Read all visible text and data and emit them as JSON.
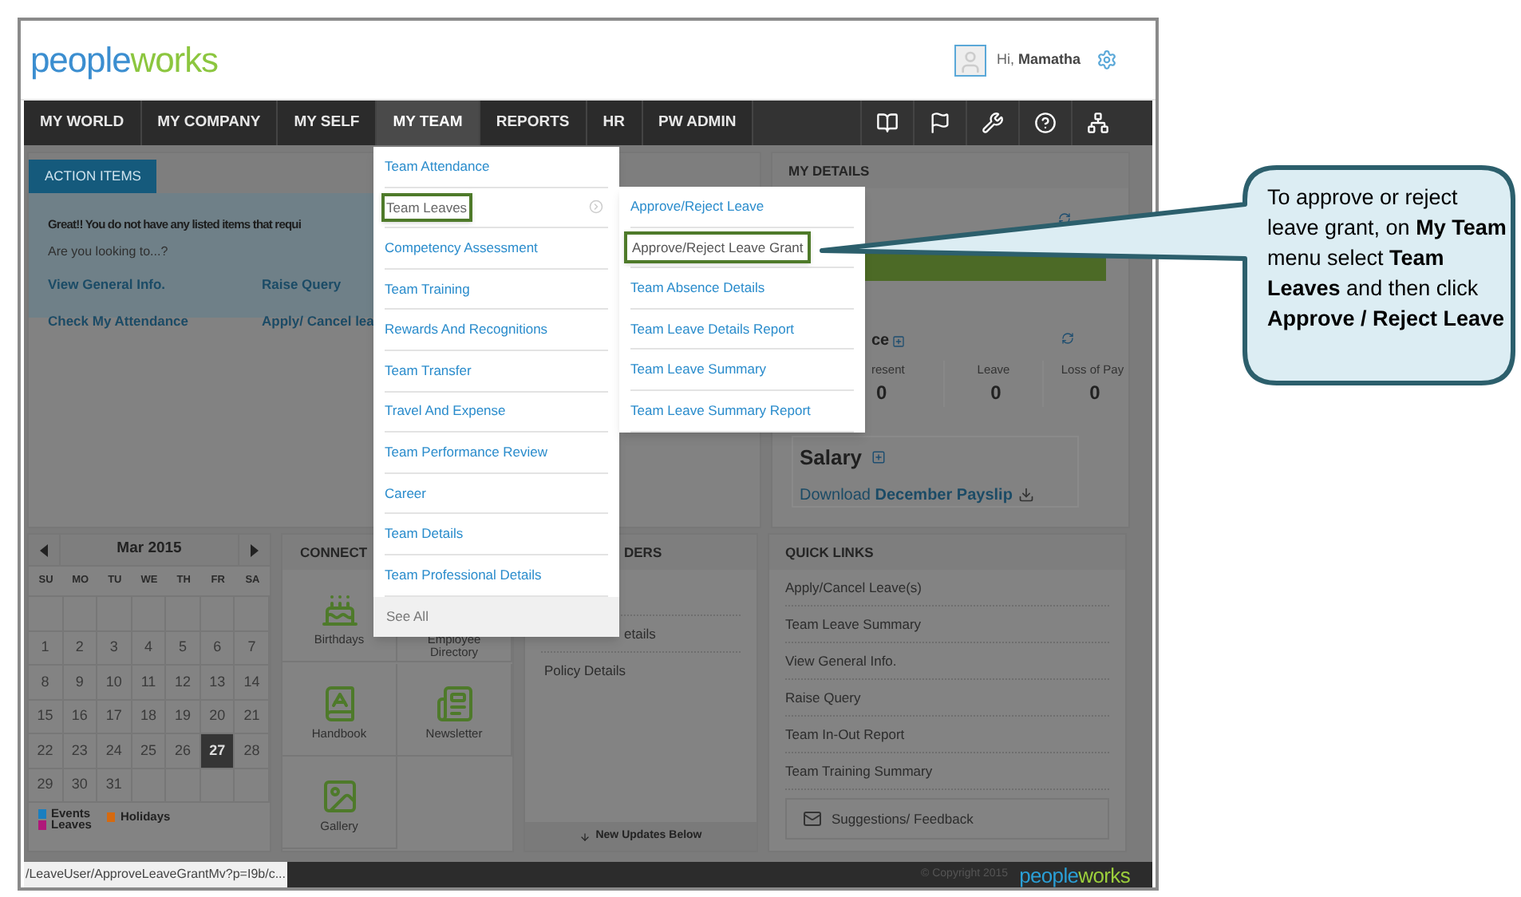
{
  "header": {
    "logo": [
      "people",
      "works"
    ],
    "greeting": "Hi,",
    "user": "Mamatha"
  },
  "nav": [
    {
      "label": "MY WORLD",
      "selected": false
    },
    {
      "label": "MY COMPANY",
      "selected": false
    },
    {
      "label": "MY SELF",
      "selected": false
    },
    {
      "label": "MY TEAM",
      "selected": true
    },
    {
      "label": "REPORTS",
      "selected": false
    },
    {
      "label": "HR",
      "selected": false
    },
    {
      "label": "PW ADMIN",
      "selected": false
    }
  ],
  "action_items": {
    "tab": "ACTION ITEMS",
    "message": "Great!! You do not have any listed items that requi",
    "prompt": "Are you looking to...?",
    "links": [
      "View General Info.",
      "Raise Query",
      "Check My Attendance",
      "Apply/ Cancel lea"
    ]
  },
  "my_details": {
    "title": "MY DETAILS",
    "attendance_title": "ce",
    "columns": [
      {
        "label": "resent",
        "value": "0"
      },
      {
        "label": "Leave",
        "value": "0"
      },
      {
        "label": "Loss of Pay",
        "value": "0"
      }
    ],
    "salary_title": "Salary",
    "payslip": "Download **December Payslip**"
  },
  "calendar": {
    "month": "Mar 2015",
    "weekdays": [
      "SU",
      "MO",
      "TU",
      "WE",
      "TH",
      "FR",
      "SA"
    ],
    "leading_blank_week": true,
    "weeks": [
      [
        {
          "d": "1",
          "selected": false
        },
        {
          "d": "2",
          "selected": false
        },
        {
          "d": "3",
          "selected": false
        },
        {
          "d": "4",
          "selected": false
        },
        {
          "d": "5",
          "selected": false
        },
        {
          "d": "6",
          "selected": false
        },
        {
          "d": "7",
          "selected": false
        }
      ],
      [
        {
          "d": "8",
          "selected": false
        },
        {
          "d": "9",
          "selected": false
        },
        {
          "d": "10",
          "selected": false
        },
        {
          "d": "11",
          "selected": false
        },
        {
          "d": "12",
          "selected": false
        },
        {
          "d": "13",
          "selected": false
        },
        {
          "d": "14",
          "selected": false
        }
      ],
      [
        {
          "d": "15",
          "selected": false
        },
        {
          "d": "16",
          "selected": false
        },
        {
          "d": "17",
          "selected": false
        },
        {
          "d": "18",
          "selected": false
        },
        {
          "d": "19",
          "selected": false
        },
        {
          "d": "20",
          "selected": false
        },
        {
          "d": "21",
          "selected": false
        }
      ],
      [
        {
          "d": "22",
          "selected": false
        },
        {
          "d": "23",
          "selected": false
        },
        {
          "d": "24",
          "selected": false
        },
        {
          "d": "25",
          "selected": false
        },
        {
          "d": "26",
          "selected": false
        },
        {
          "d": "27",
          "selected": true
        },
        {
          "d": "28",
          "selected": false
        }
      ],
      [
        {
          "d": "29",
          "selected": false
        },
        {
          "d": "30",
          "selected": false
        },
        {
          "d": "31",
          "selected": false
        }
      ]
    ],
    "legend": [
      {
        "label": "Events",
        "color": "#1a7fc0"
      },
      {
        "label": "Leaves",
        "color": "#b0187a"
      },
      {
        "label": "Holidays",
        "color": "#d66a10"
      }
    ]
  },
  "connect": {
    "title": "CONNECT",
    "tiles": [
      {
        "label": "Birthdays",
        "kind": "cake"
      },
      {
        "label": "Employee Directory",
        "kind": "directory"
      },
      {
        "label": "Handbook",
        "kind": "book"
      },
      {
        "label": "Newsletter",
        "kind": "news"
      },
      {
        "label": "Gallery",
        "kind": "gallery"
      }
    ]
  },
  "reminders": {
    "title": "DERS",
    "items": [
      "etails",
      "Policy Details"
    ],
    "footer": "New Updates Below"
  },
  "quick_links": {
    "title": "QUICK LINKS",
    "items": [
      "Apply/Cancel Leave(s)",
      "Team Leave Summary",
      "View General Info.",
      "Raise Query",
      "Team In-Out Report",
      "Team Training Summary"
    ],
    "feedback": "Suggestions/ Feedback"
  },
  "footer": {
    "copyright": "© Copyright 2015",
    "logo": [
      "people",
      "works"
    ]
  },
  "status_url": "/LeaveUser/ApproveLeaveGrantMv?p=I9b/c...",
  "menu": {
    "items": [
      {
        "label": "Team Attendance",
        "kind": "link",
        "highlighted": false,
        "has_submenu": false
      },
      {
        "label": "Team Leaves",
        "kind": "link",
        "highlighted": true,
        "has_submenu": true
      },
      {
        "label": "Competency Assessment",
        "kind": "link",
        "highlighted": false,
        "has_submenu": false
      },
      {
        "label": "Team Training",
        "kind": "link",
        "highlighted": false,
        "has_submenu": false
      },
      {
        "label": "Rewards And Recognitions",
        "kind": "link",
        "highlighted": false,
        "has_submenu": false
      },
      {
        "label": "Team Transfer",
        "kind": "link",
        "highlighted": false,
        "has_submenu": false
      },
      {
        "label": "Travel And Expense",
        "kind": "link",
        "highlighted": false,
        "has_submenu": false
      },
      {
        "label": "Team Performance Review",
        "kind": "link",
        "highlighted": false,
        "has_submenu": false
      },
      {
        "label": "Career",
        "kind": "link",
        "highlighted": false,
        "has_submenu": false
      },
      {
        "label": "Team Details",
        "kind": "link",
        "highlighted": false,
        "has_submenu": false
      },
      {
        "label": "Team Professional Details",
        "kind": "link",
        "highlighted": false,
        "has_submenu": false
      },
      {
        "label": "See All",
        "kind": "more",
        "highlighted": false,
        "has_submenu": false
      }
    ],
    "submenu": [
      {
        "label": "Approve/Reject Leave",
        "highlighted": false
      },
      {
        "label": "Approve/Reject Leave Grant",
        "highlighted": true
      },
      {
        "label": "Team Absence Details",
        "highlighted": false
      },
      {
        "label": "Team Leave Details Report",
        "highlighted": false
      },
      {
        "label": "Team Leave Summary",
        "highlighted": false
      },
      {
        "label": "Team Leave Summary Report",
        "highlighted": false
      }
    ]
  },
  "callout": "To approve or reject leave grant,  on **My Team** menu select **Team Leaves** and then click **Approve / Reject Leave**"
}
